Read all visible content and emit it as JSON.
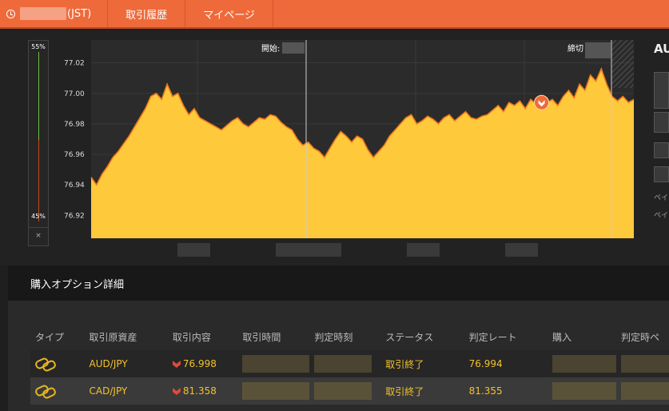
{
  "topbar": {
    "clock_suffix": "(JST)",
    "history": "取引履歴",
    "mypage": "マイページ"
  },
  "gauge": {
    "top": "55%",
    "bottom": "45%",
    "close": "×"
  },
  "chart": {
    "start_label": "開始:",
    "end_label": "締切",
    "up_color": "#6bbf3a",
    "down_color": "#c2471f",
    "fill_color": "#ffc93c",
    "line_color": "#f07a1a"
  },
  "chart_data": {
    "type": "area",
    "yticks": [
      "77.02",
      "77.00",
      "76.98",
      "76.96",
      "76.94",
      "76.92"
    ],
    "ylim": [
      76.905,
      77.035
    ],
    "x": [
      0,
      1,
      2,
      3,
      4,
      5,
      6,
      7,
      8,
      9,
      10,
      11,
      12,
      13,
      14,
      15,
      16,
      17,
      18,
      19,
      20,
      21,
      22,
      23,
      24,
      25,
      26,
      27,
      28,
      29,
      30,
      31,
      32,
      33,
      34,
      35,
      36,
      37,
      38,
      39,
      40,
      41,
      42,
      43,
      44,
      45,
      46,
      47,
      48,
      49,
      50,
      51,
      52,
      53,
      54,
      55,
      56,
      57,
      58,
      59,
      60,
      61,
      62,
      63,
      64,
      65,
      66,
      67,
      68,
      69,
      70,
      71,
      72,
      73,
      74,
      75,
      76,
      77,
      78,
      79,
      80,
      81,
      82,
      83,
      84,
      85,
      86,
      87,
      88,
      89,
      90,
      91,
      92,
      93,
      94,
      95,
      96,
      97,
      98,
      99,
      100
    ],
    "values": [
      76.945,
      76.94,
      76.947,
      76.952,
      76.958,
      76.962,
      76.967,
      76.972,
      76.978,
      76.984,
      76.99,
      76.998,
      77.0,
      76.996,
      77.006,
      76.998,
      77.0,
      76.992,
      76.986,
      76.99,
      76.984,
      76.982,
      76.98,
      76.978,
      76.976,
      76.979,
      76.982,
      76.984,
      76.98,
      76.978,
      76.981,
      76.984,
      76.983,
      76.986,
      76.985,
      76.981,
      76.978,
      76.976,
      76.97,
      76.966,
      76.968,
      76.964,
      76.962,
      76.958,
      76.964,
      76.97,
      76.975,
      76.972,
      76.968,
      76.972,
      76.97,
      76.963,
      76.958,
      76.962,
      76.966,
      76.972,
      76.976,
      76.98,
      76.984,
      76.986,
      76.98,
      76.982,
      76.985,
      76.983,
      76.98,
      76.984,
      76.986,
      76.982,
      76.985,
      76.988,
      76.984,
      76.983,
      76.985,
      76.986,
      76.989,
      76.992,
      76.988,
      76.994,
      76.992,
      76.995,
      76.99,
      76.996,
      76.993,
      76.998,
      76.994,
      76.996,
      76.992,
      76.998,
      77.002,
      76.997,
      77.006,
      77.002,
      77.012,
      77.008,
      77.016,
      77.006,
      76.998,
      76.995,
      76.998,
      76.994,
      76.996
    ],
    "marker_x": 83,
    "marker_value": 76.994
  },
  "right_panel": {
    "title": "AU",
    "note1": "ペイ",
    "note2": "ペイ"
  },
  "section": {
    "title": "購入オプション詳細"
  },
  "table": {
    "headers": [
      "タイプ",
      "取引原資産",
      "取引内容",
      "取引時間",
      "判定時刻",
      "ステータス",
      "判定レート",
      "購入",
      "判定時ペ"
    ],
    "rows": [
      {
        "asset": "AUD/JPY",
        "rate": "76.998",
        "status": "取引終了",
        "judge_rate": "76.994"
      },
      {
        "asset": "CAD/JPY",
        "rate": "81.358",
        "status": "取引終了",
        "judge_rate": "81.355"
      }
    ]
  }
}
